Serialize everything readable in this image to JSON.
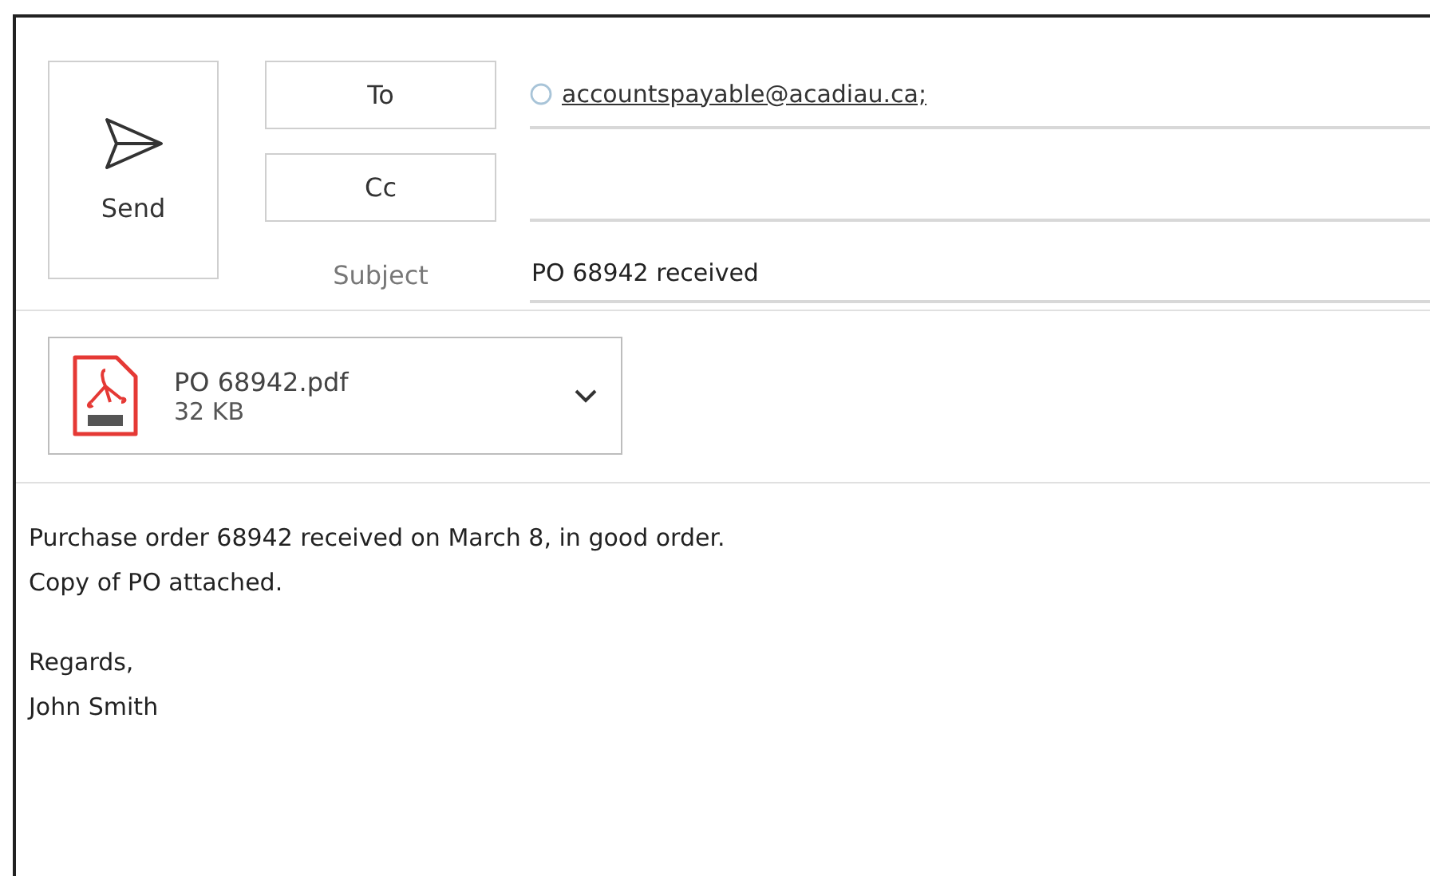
{
  "send_button": {
    "label": "Send"
  },
  "recipients": [
    {
      "label": "To",
      "addresses": [
        "accountspayable@acadiau.ca;"
      ]
    },
    {
      "label": "Cc"
    }
  ],
  "subject": {
    "label": "Subject",
    "value": "PO 68942 received"
  },
  "attachment": {
    "name": "PO 68942.pdf",
    "size": "32 KB"
  },
  "body": {
    "paragraphs": [
      [
        "Purchase order 68942 received on March 8, in good order.",
        "Copy of PO attached."
      ],
      [
        "Regards,",
        "John Smith"
      ]
    ]
  }
}
